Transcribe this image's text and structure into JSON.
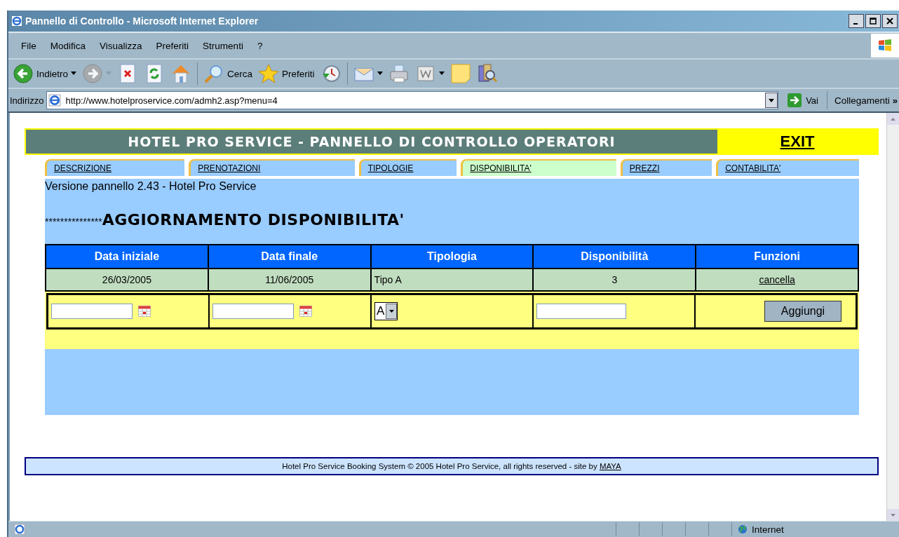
{
  "window": {
    "title": "Pannello di Controllo - Microsoft Internet Explorer"
  },
  "menu": [
    "File",
    "Modifica",
    "Visualizza",
    "Preferiti",
    "Strumenti",
    "?"
  ],
  "toolbar": [
    {
      "kind": "back",
      "label": "Indietro",
      "disabled": false
    },
    {
      "kind": "forward",
      "disabled": true
    },
    {
      "kind": "stop"
    },
    {
      "kind": "refresh"
    },
    {
      "kind": "home"
    },
    {
      "kind": "sep"
    },
    {
      "kind": "search",
      "label": "Cerca"
    },
    {
      "kind": "favorites",
      "label": "Preferiti"
    },
    {
      "kind": "history"
    },
    {
      "kind": "sep"
    },
    {
      "kind": "mail"
    },
    {
      "kind": "print"
    },
    {
      "kind": "edit"
    },
    {
      "kind": "note"
    },
    {
      "kind": "research"
    }
  ],
  "address": {
    "label": "Indirizzo",
    "value": "http://www.hotelproservice.com/admh2.asp?menu=4",
    "go": "Vai",
    "links": "Collegamenti",
    "more": "»"
  },
  "header": {
    "title": "HOTEL PRO SERVICE - PANNELLO DI CONTROLLO OPERATORI",
    "exit": "EXIT"
  },
  "tabs": [
    {
      "label": "DESCRIZIONE",
      "selected": false
    },
    {
      "label": "PRENOTAZIONI",
      "selected": false
    },
    {
      "label": "TIPOLOGIE",
      "selected": false
    },
    {
      "label": "DISPONIBILITA'",
      "selected": true
    },
    {
      "label": "PREZZI",
      "selected": false
    },
    {
      "label": "CONTABILITA'",
      "selected": false
    }
  ],
  "version": "Versione pannello 2.43 - Hotel Pro Service",
  "section": {
    "stars": "***************",
    "title": "AGGIORNAMENTO DISPONIBILITA'"
  },
  "table": {
    "columns": [
      "Data iniziale",
      "Data finale",
      "Tipologia",
      "Disponibilità",
      "Funzioni"
    ],
    "rows": [
      {
        "start": "26/03/2005",
        "end": "11/06/2005",
        "type": "Tipo A",
        "available": "3",
        "action": "cancella"
      }
    ]
  },
  "form": {
    "type_value": "A",
    "button": "Aggiungi"
  },
  "footer": {
    "text": "Hotel Pro Service Booking System © 2005 Hotel Pro Service, all rights reserved - site by",
    "link": "MAYA"
  },
  "status": {
    "zone": "Internet"
  }
}
